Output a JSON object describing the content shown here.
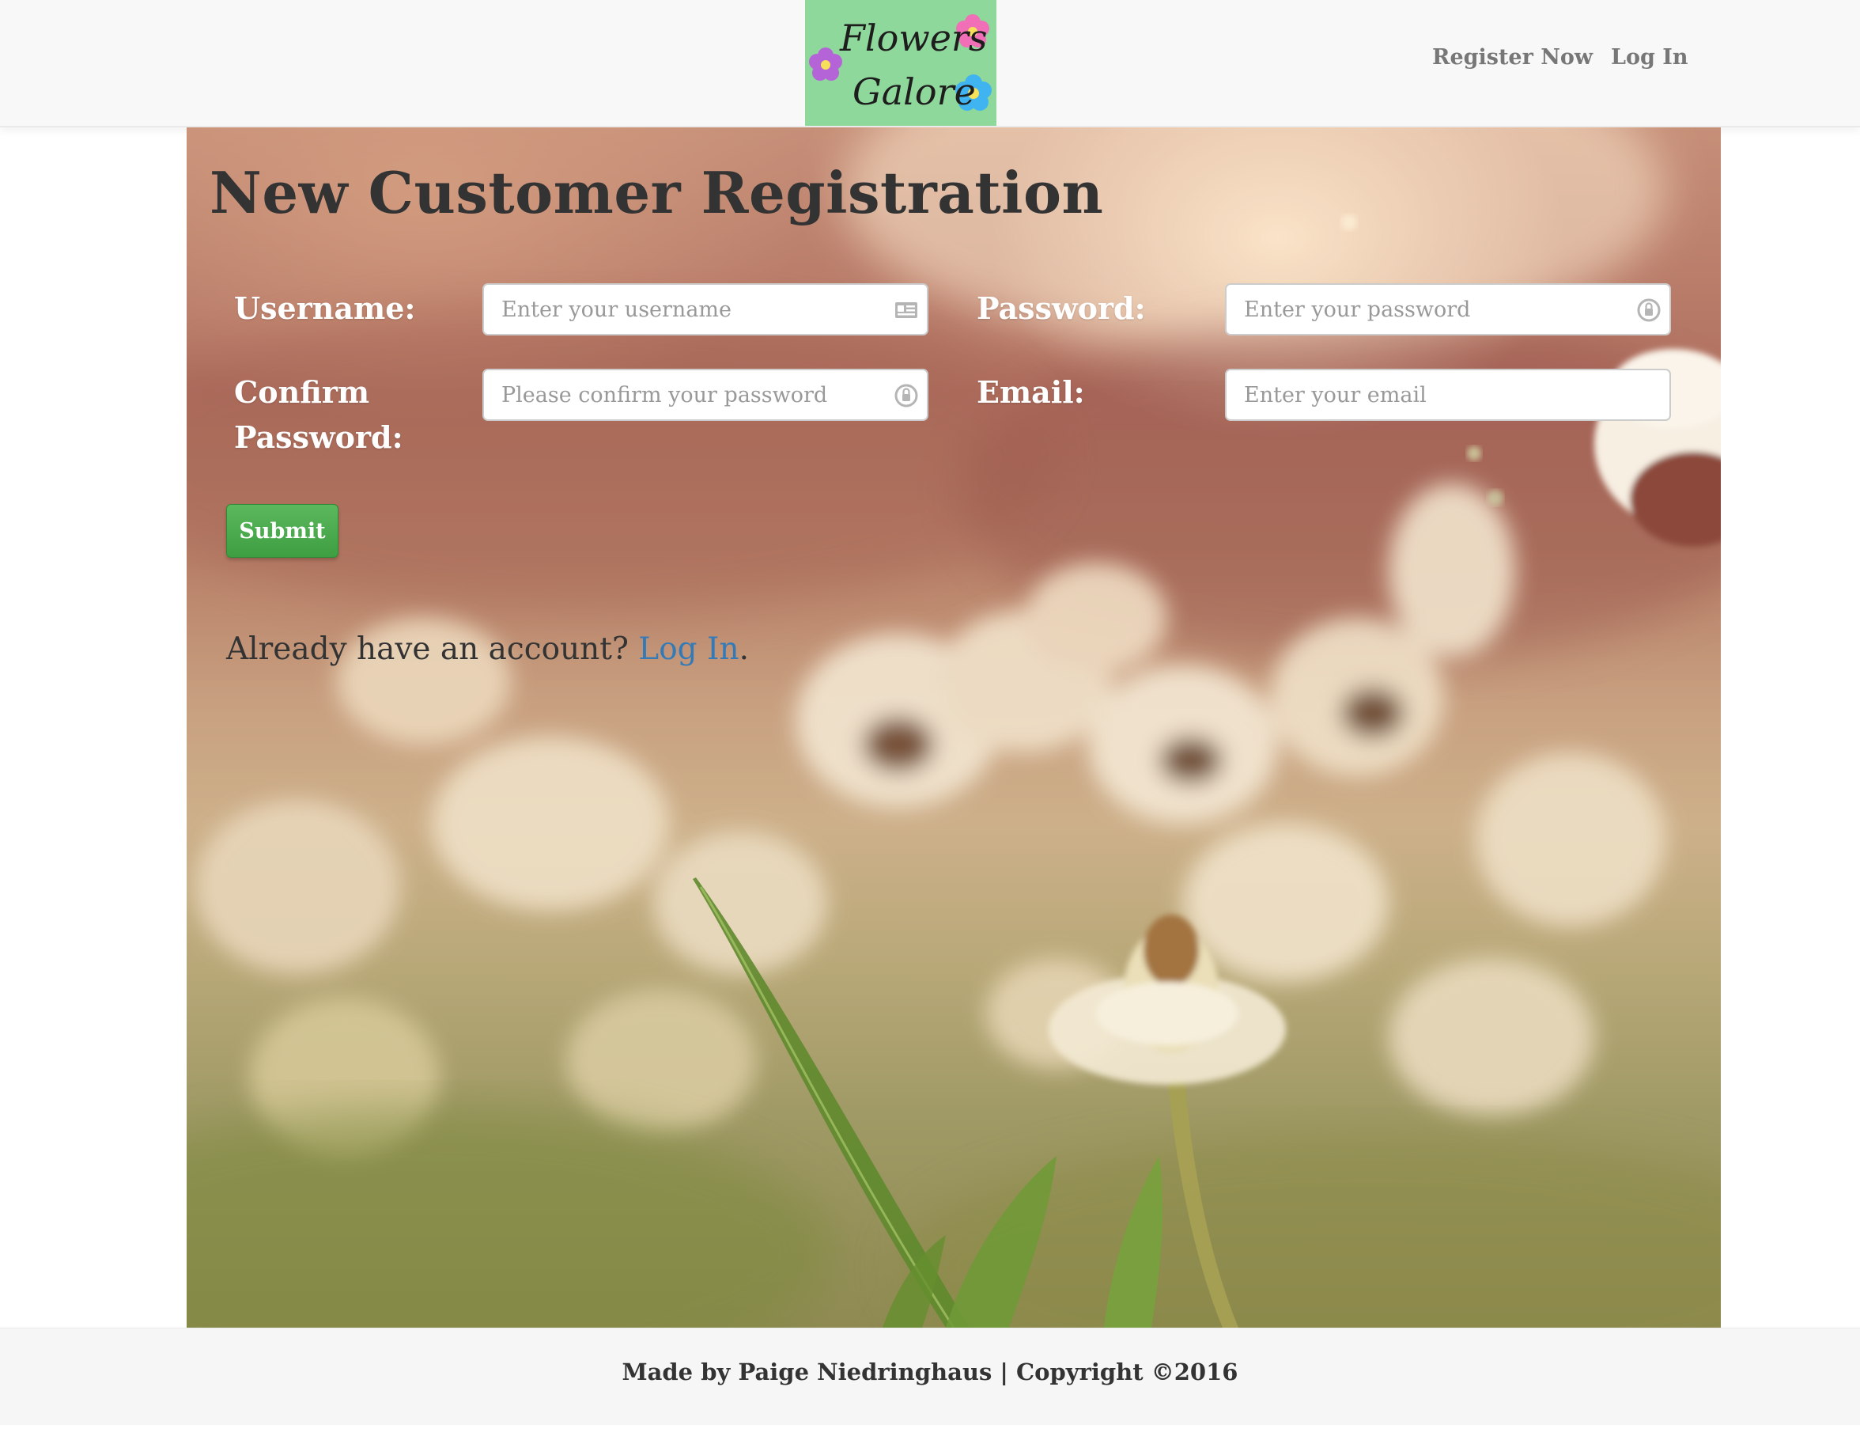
{
  "navbar": {
    "brand": {
      "line1": "Flowers",
      "line2": "Galore"
    },
    "links": [
      {
        "label": "Register Now"
      },
      {
        "label": "Log In"
      }
    ]
  },
  "page": {
    "title": "New Customer Registration"
  },
  "form": {
    "username": {
      "label": "Username:",
      "placeholder": "Enter your username",
      "value": ""
    },
    "password": {
      "label": "Password:",
      "placeholder": "Enter your password",
      "value": ""
    },
    "confirm_password": {
      "label_line1": "Confirm",
      "label_line2": "Password:",
      "placeholder": "Please confirm your password",
      "value": ""
    },
    "email": {
      "label": "Email:",
      "placeholder": "Enter your email",
      "value": ""
    },
    "submit_label": "Submit"
  },
  "account_prompt": {
    "text": "Already have an account? ",
    "link": "Log In",
    "suffix": "."
  },
  "footer": {
    "text": "Made by Paige Niedringhaus | Copyright ©2016"
  },
  "colors": {
    "logo_bg": "#8fd89b",
    "submit": "#5cb85c",
    "link": "#337ab7"
  }
}
